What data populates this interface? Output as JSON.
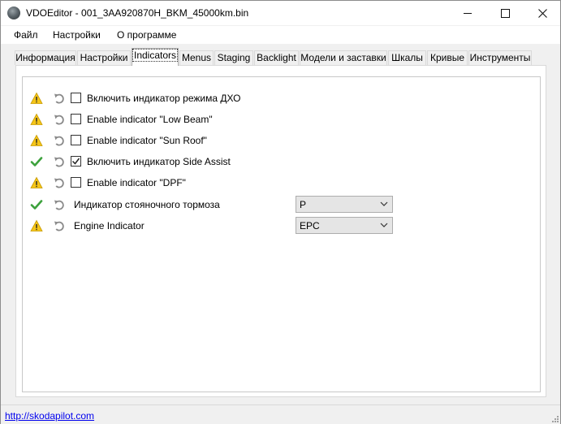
{
  "window": {
    "title": "VDOEditor - 001_3AA920870H_BKM_45000km.bin"
  },
  "menu": [
    {
      "label": "Файл"
    },
    {
      "label": "Настройки"
    },
    {
      "label": "О программе"
    }
  ],
  "tabs": [
    {
      "label": "Информация"
    },
    {
      "label": "Настройки"
    },
    {
      "label": "Indicators",
      "active": true
    },
    {
      "label": "Menus"
    },
    {
      "label": "Staging"
    },
    {
      "label": "Backlight"
    },
    {
      "label": "Модели и заставки"
    },
    {
      "label": "Шкалы"
    },
    {
      "label": "Кривые"
    },
    {
      "label": "Инструменты"
    }
  ],
  "indicators": [
    {
      "status": "warning",
      "type": "checkbox",
      "checked": false,
      "label": "Включить индикатор режима ДХО"
    },
    {
      "status": "warning",
      "type": "checkbox",
      "checked": false,
      "label": "Enable indicator \"Low Beam\""
    },
    {
      "status": "warning",
      "type": "checkbox",
      "checked": false,
      "label": "Enable indicator \"Sun Roof\""
    },
    {
      "status": "ok",
      "type": "checkbox",
      "checked": true,
      "label": "Включить индикатор Side Assist"
    },
    {
      "status": "warning",
      "type": "checkbox",
      "checked": false,
      "label": "Enable indicator \"DPF\""
    },
    {
      "status": "ok",
      "type": "select",
      "label": "Индикатор стояночного тормоза",
      "value": "P"
    },
    {
      "status": "warning",
      "type": "select",
      "label": "Engine Indicator",
      "value": "EPC"
    }
  ],
  "statusbar": {
    "link": "http://skodapilot.com"
  },
  "colors": {
    "warning": "#f5c518",
    "ok": "#3ca13c",
    "link": "#0000ee"
  }
}
